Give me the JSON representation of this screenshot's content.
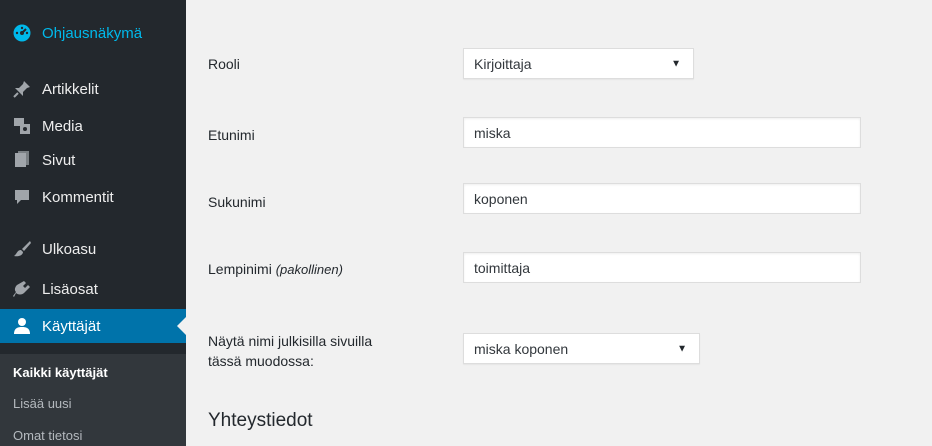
{
  "sidebar": {
    "items": [
      {
        "label": "Ohjausnäkymä",
        "icon": "dashboard-icon"
      },
      {
        "label": "Artikkelit",
        "icon": "pin-icon"
      },
      {
        "label": "Media",
        "icon": "media-icon"
      },
      {
        "label": "Sivut",
        "icon": "pages-icon"
      },
      {
        "label": "Kommentit",
        "icon": "comments-icon"
      },
      {
        "label": "Ulkoasu",
        "icon": "brush-icon"
      },
      {
        "label": "Lisäosat",
        "icon": "plugins-icon"
      },
      {
        "label": "Käyttäjät",
        "icon": "users-icon"
      }
    ],
    "submenu": [
      {
        "label": "Kaikki käyttäjät"
      },
      {
        "label": "Lisää uusi"
      },
      {
        "label": "Omat tietosi"
      }
    ]
  },
  "form": {
    "role": {
      "label": "Rooli",
      "value": "Kirjoittaja"
    },
    "first_name": {
      "label": "Etunimi",
      "value": "miska"
    },
    "last_name": {
      "label": "Sukunimi",
      "value": "koponen"
    },
    "nickname": {
      "label": "Lempinimi",
      "label_note": "(pakollinen)",
      "value": "toimittaja"
    },
    "display_name": {
      "label_line1": "Näytä nimi julkisilla sivuilla",
      "label_line2": "tässä muodossa:",
      "value": "miska koponen"
    }
  },
  "section": {
    "title": "Yhteystiedot"
  },
  "colors": {
    "sidebar_bg": "#23282d",
    "active_bg": "#0073aa",
    "link_blue": "#00b9eb",
    "page_bg": "#f1f1f1"
  }
}
